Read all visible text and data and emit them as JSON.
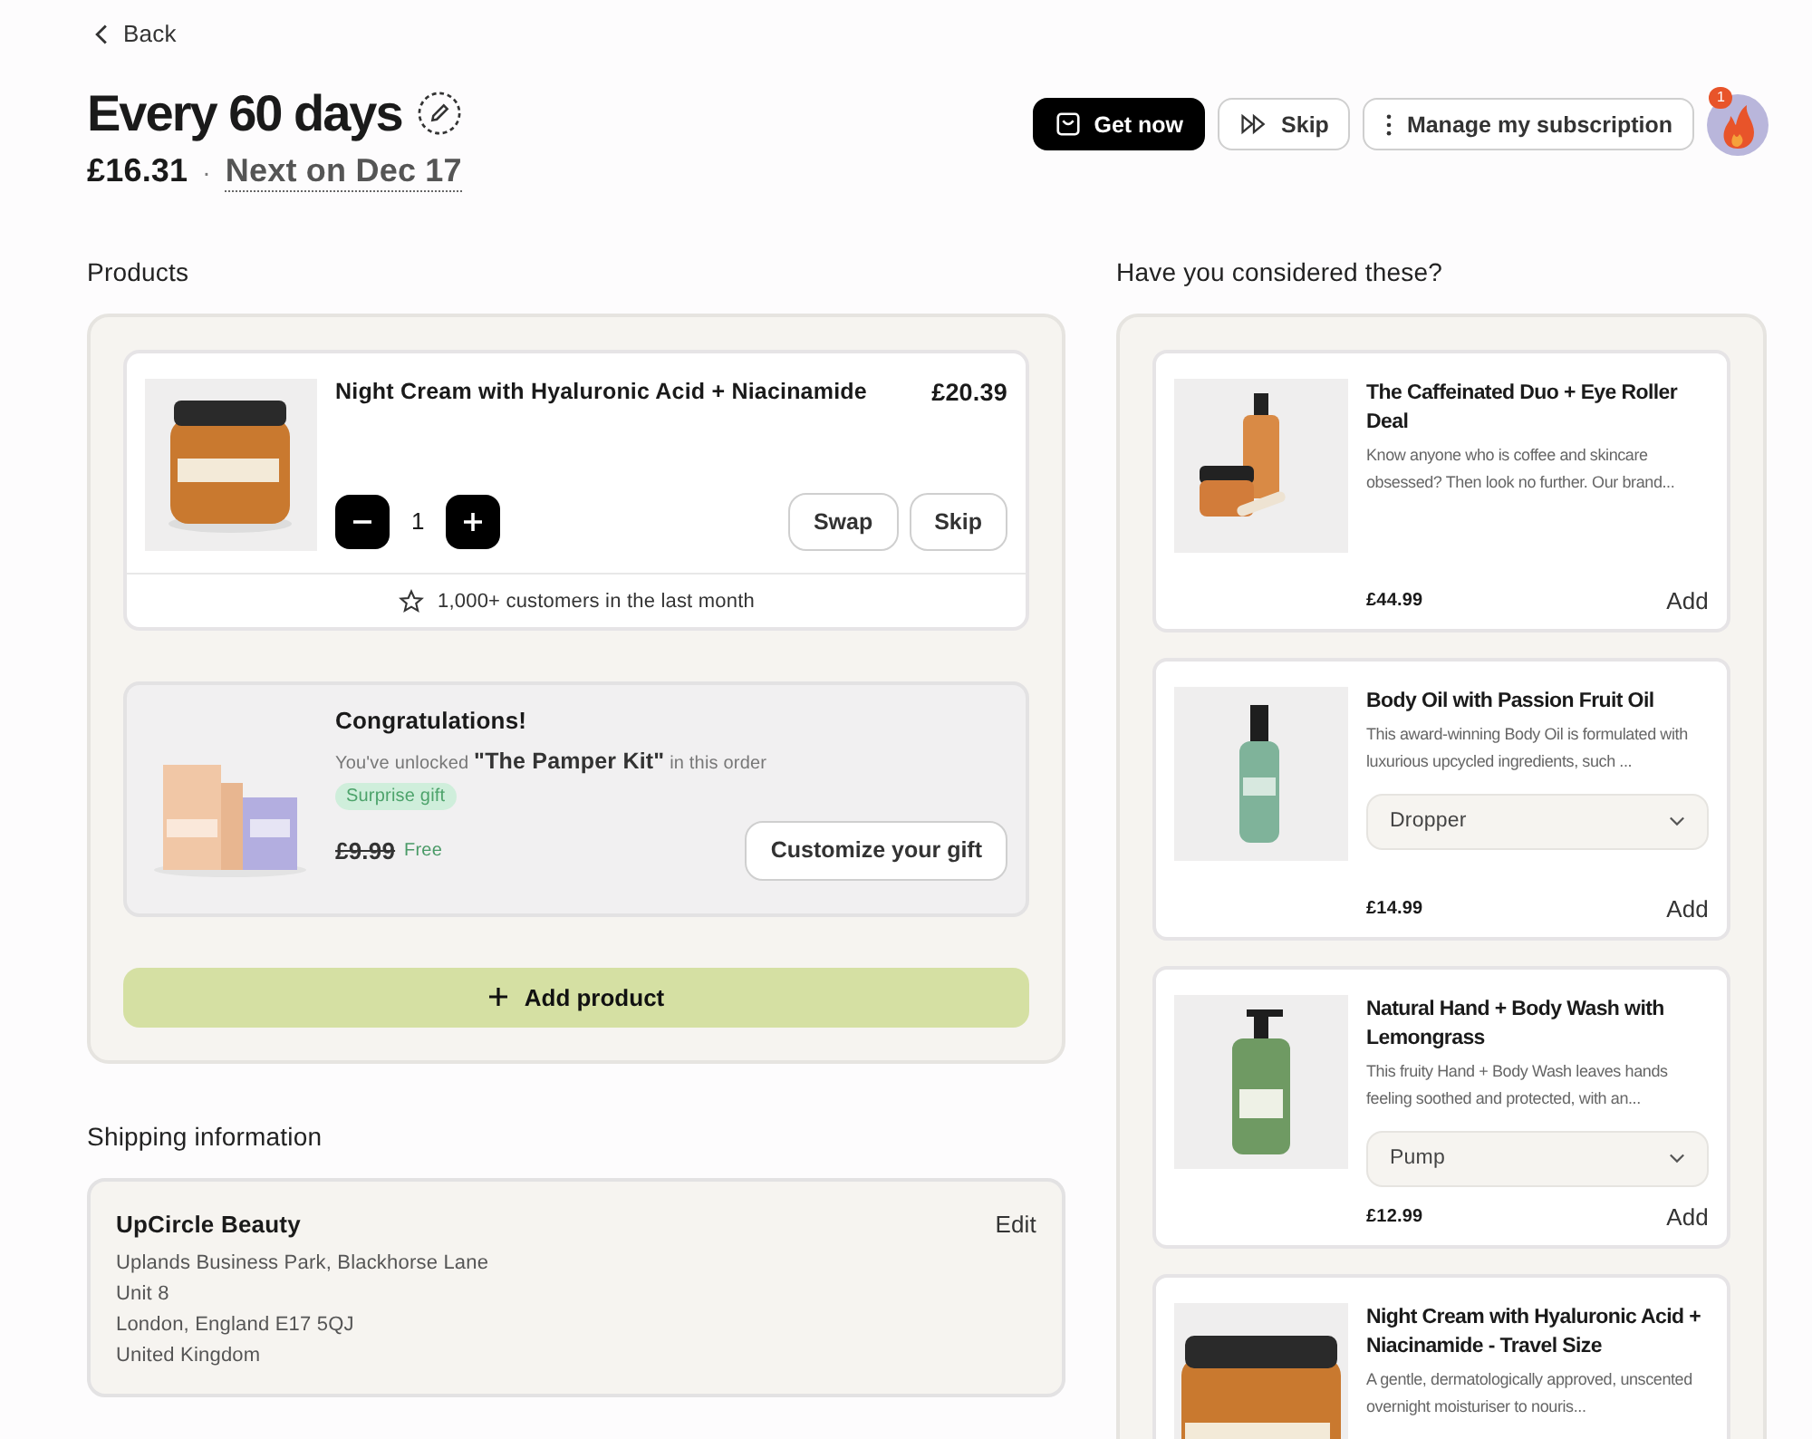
{
  "back_link": {
    "label": "Back"
  },
  "header": {
    "title": "Every 60 days",
    "price": "£16.31",
    "separator": "·",
    "next_date": "Next on Dec 17"
  },
  "actions": [
    {
      "label": "Get now",
      "kind": "primary"
    },
    {
      "label": "Skip",
      "kind": "skip"
    },
    {
      "label": "Manage my subscription",
      "kind": "menu"
    }
  ],
  "avatar": {
    "badge": "1"
  },
  "products": {
    "heading": "Products",
    "items": [
      {
        "name": "Night Cream with Hyaluronic Acid + Niacinamide",
        "price": "£20.39",
        "quantity": "1",
        "buttons": [
          "Swap",
          "Skip"
        ],
        "social_proof": "1,000+ customers in the last month",
        "image": {
          "kind": "picture"
        }
      }
    ],
    "gift": {
      "title": "Congratulations!",
      "message": "You've unlocked **\"The Pamper Kit\"** in this order",
      "tag": "Surprise gift",
      "old_price": "£9.99",
      "price": "Free",
      "button": "Customize your gift"
    },
    "add_button": "Add product"
  },
  "shipping": {
    "heading": "Shipping information",
    "name": "UpCircle Beauty",
    "edit": "Edit",
    "address_lines": [
      "Uplands Business Park, Blackhorse Lane",
      "Unit 8",
      "London, England E17 5QJ",
      "United Kingdom"
    ]
  },
  "recommendations": {
    "heading": "Have you considered these?",
    "items": [
      {
        "name": "The Caffeinated Duo + Eye Roller Deal",
        "description": "Know anyone who is coffee and skincare obsessed? Then look no further. Our brand...",
        "price": "£44.99",
        "add": "Add",
        "image": {
          "kind": "picture"
        }
      },
      {
        "name": "Body Oil with Passion Fruit Oil",
        "description": "This award-winning Body Oil is formulated with luxurious upcycled ingredients, such ...",
        "option": "Dropper",
        "price": "£14.99",
        "add": "Add",
        "image": {
          "kind": "picture"
        }
      },
      {
        "name": "Natural Hand + Body Wash with Lemongrass",
        "description": "This fruity Hand + Body Wash leaves hands feeling soothed and protected, with an...",
        "option": "Pump",
        "price": "£12.99",
        "add": "Add",
        "image": {
          "kind": "picture"
        }
      },
      {
        "name": "Night Cream with Hyaluronic Acid + Niacinamide - Travel Size",
        "description": "A gentle, dermatologically approved, unscented overnight moisturiser to nouris...",
        "image": {
          "kind": "picture"
        }
      }
    ]
  }
}
